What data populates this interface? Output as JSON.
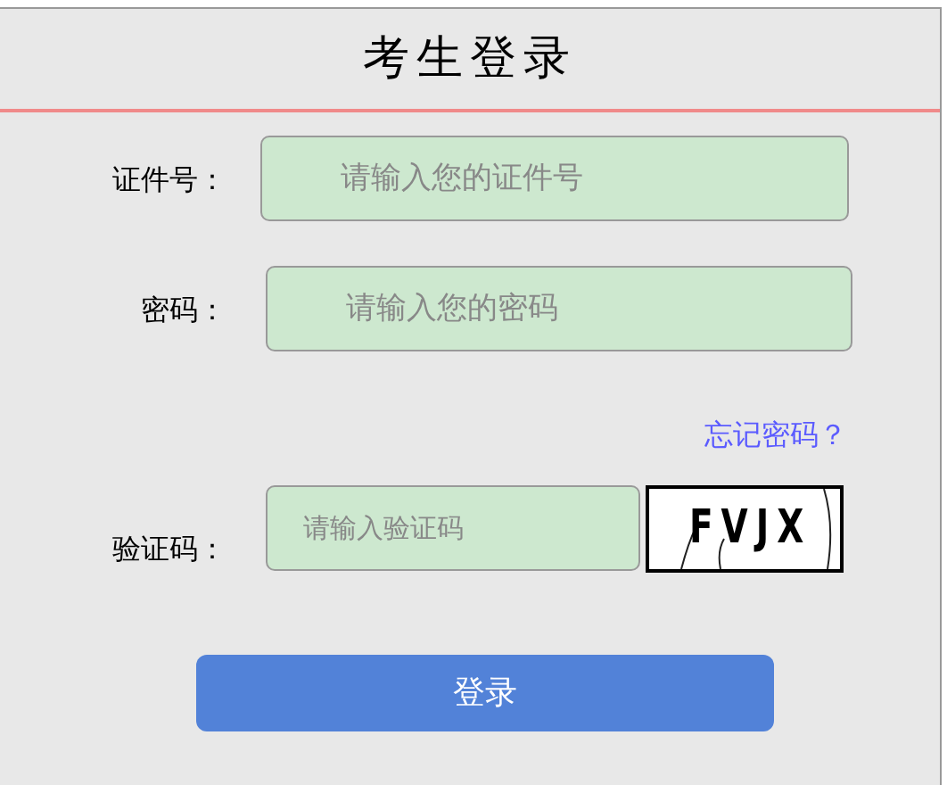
{
  "title": "考生登录",
  "fields": [
    {
      "label": "证件号：",
      "placeholder": "请输入您的证件号"
    },
    {
      "label": "密码：",
      "placeholder": "请输入您的密码"
    }
  ],
  "forgot_link": "忘记密码？",
  "captcha": {
    "label": "验证码：",
    "placeholder": "请输入验证码",
    "code": "FVJX"
  },
  "login_button": "登录"
}
